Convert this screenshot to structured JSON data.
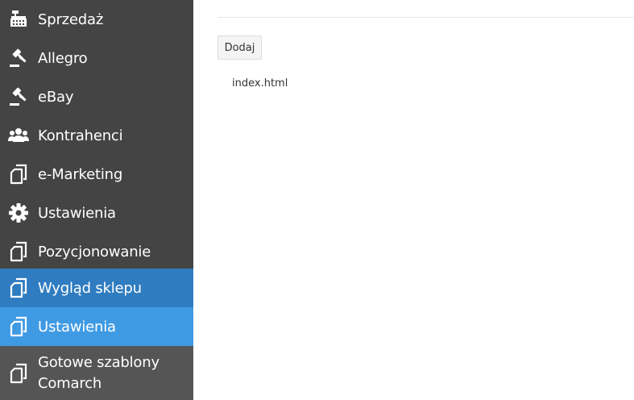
{
  "colors": {
    "sidebar_bg": "#444444",
    "submenu_bg": "#2f7cc0",
    "active_bg": "#3f9ae4",
    "templates_bg": "#555555",
    "text_light": "#ffffff"
  },
  "sidebar": {
    "items": [
      {
        "label": "Sprzedaż",
        "icon": "cash-register-icon"
      },
      {
        "label": "Allegro",
        "icon": "gavel-icon"
      },
      {
        "label": "eBay",
        "icon": "gavel-icon"
      },
      {
        "label": "Kontrahenci",
        "icon": "users-icon"
      },
      {
        "label": "e-Marketing",
        "icon": "documents-icon"
      },
      {
        "label": "Ustawienia",
        "icon": "gear-icon"
      },
      {
        "label": "Pozycjonowanie",
        "icon": "documents-icon"
      },
      {
        "label": "Wygląd sklepu",
        "icon": "documents-icon"
      },
      {
        "label": "Ustawienia",
        "icon": "documents-icon"
      },
      {
        "label": "Gotowe szablony Comarch",
        "icon": "documents-icon"
      }
    ]
  },
  "main": {
    "add_button_label": "Dodaj",
    "files": [
      "index.html"
    ]
  }
}
